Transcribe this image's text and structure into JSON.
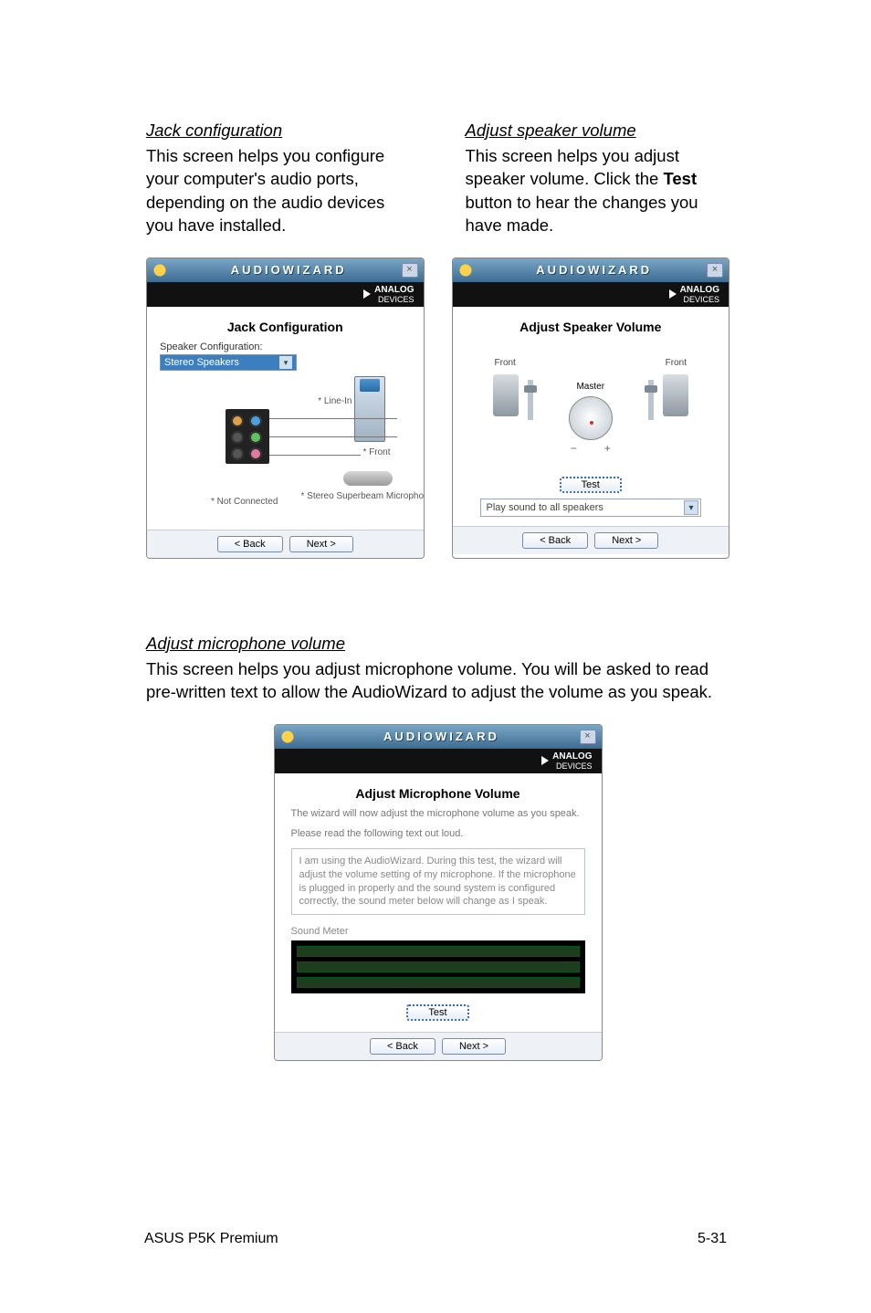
{
  "section1": {
    "jack": {
      "title": "Jack configuration",
      "body1": "This screen helps you configure your computer's audio ports, depending on the audio devices you have installed."
    },
    "spk": {
      "title": "Adjust speaker volume",
      "body1_a": "This screen helps you adjust speaker volume. Click the ",
      "body1_b": "Test",
      "body1_c": " button to hear the changes you have made."
    }
  },
  "section2": {
    "mic": {
      "title": "Adjust microphone volume",
      "body": "This screen helps you adjust microphone volume. You will be asked to read pre-written text to allow the AudioWizard to adjust the volume as you speak."
    }
  },
  "wizard": {
    "title": "AUDIOWIZARD",
    "brand": "ANALOG DEVICES",
    "back": "< Back",
    "next": "Next >"
  },
  "jack_dlg": {
    "heading": "Jack Configuration",
    "spk_conf_label": "Speaker Configuration:",
    "spk_conf_value": "Stereo Speakers",
    "tag_linein": "* Line-In",
    "tag_front": "* Front",
    "tag_notconn": "* Not Connected",
    "tag_superbeam": "* Stereo Superbeam Microphone"
  },
  "spk_dlg": {
    "heading": "Adjust Speaker Volume",
    "front": "Front",
    "master": "Master",
    "test": "Test",
    "select": "Play sound to all speakers"
  },
  "mic_dlg": {
    "heading": "Adjust Microphone Volume",
    "sub": "The wizard will now adjust the microphone volume as you speak.",
    "read_label": "Please read the following text out loud.",
    "read_text": "I am using the AudioWizard. During this test, the wizard will adjust the volume setting of my microphone. If the microphone is plugged in properly and the sound system is configured correctly, the sound meter below will change as I speak.",
    "meter_label": "Sound Meter",
    "test": "Test"
  },
  "footer": {
    "left": "ASUS P5K Premium",
    "right": "5-31"
  }
}
